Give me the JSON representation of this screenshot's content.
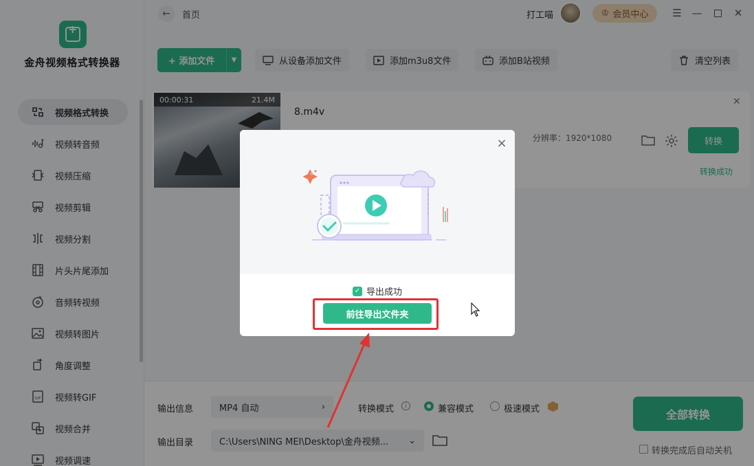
{
  "app": {
    "name": "金舟视频格式转换器"
  },
  "header": {
    "back_icon": "arrow-left-icon",
    "home_label": "首页",
    "user_name": "打工喵",
    "vip_label": "会员中心",
    "window_controls": [
      "menu-icon",
      "minimize-icon",
      "maximize-icon",
      "close-icon"
    ]
  },
  "sidebar": {
    "items": [
      {
        "label": "视频格式转换",
        "icon": "convert-icon",
        "active": true
      },
      {
        "label": "视频转音频",
        "icon": "audio-icon"
      },
      {
        "label": "视频压缩",
        "icon": "compress-icon"
      },
      {
        "label": "视频剪辑",
        "icon": "scissors-icon"
      },
      {
        "label": "视频分割",
        "icon": "split-icon"
      },
      {
        "label": "片头片尾添加",
        "icon": "film-icon"
      },
      {
        "label": "音频转视频",
        "icon": "music-disc-icon"
      },
      {
        "label": "视频转图片",
        "icon": "image-icon"
      },
      {
        "label": "角度调整",
        "icon": "rotate-icon"
      },
      {
        "label": "视频转GIF",
        "icon": "gif-icon"
      },
      {
        "label": "视频合并",
        "icon": "merge-icon"
      },
      {
        "label": "视频调速",
        "icon": "speed-icon"
      }
    ]
  },
  "toolbar": {
    "add_file": "添加文件",
    "add_from_device": "从设备添加文件",
    "add_m3u8": "添加m3u8文件",
    "add_bilibili": "添加B站视频",
    "clear_list": "清空列表"
  },
  "file": {
    "duration": "00:00:31",
    "size": "21.4M",
    "name": "8.m4v",
    "resolution": "分辨率：1920*1080",
    "convert_label": "转换",
    "status": "转换成功"
  },
  "bottom": {
    "output_info_label": "输出信息",
    "format_value": "MP4 自动",
    "mode_label": "转换模式",
    "mode_compat": "兼容模式",
    "mode_fast": "极速模式",
    "output_dir_label": "输出目录",
    "output_dir_value": "C:\\Users\\NING MEI\\Desktop\\金舟视频...",
    "convert_all": "全部转换",
    "auto_shutdown": "转换完成后自动关机"
  },
  "modal": {
    "success_text": "导出成功",
    "open_folder_button": "前往导出文件夹"
  },
  "colors": {
    "accent": "#2fb98b",
    "annotation_red": "#e03333",
    "vip_bg": "#f3d7b9"
  }
}
